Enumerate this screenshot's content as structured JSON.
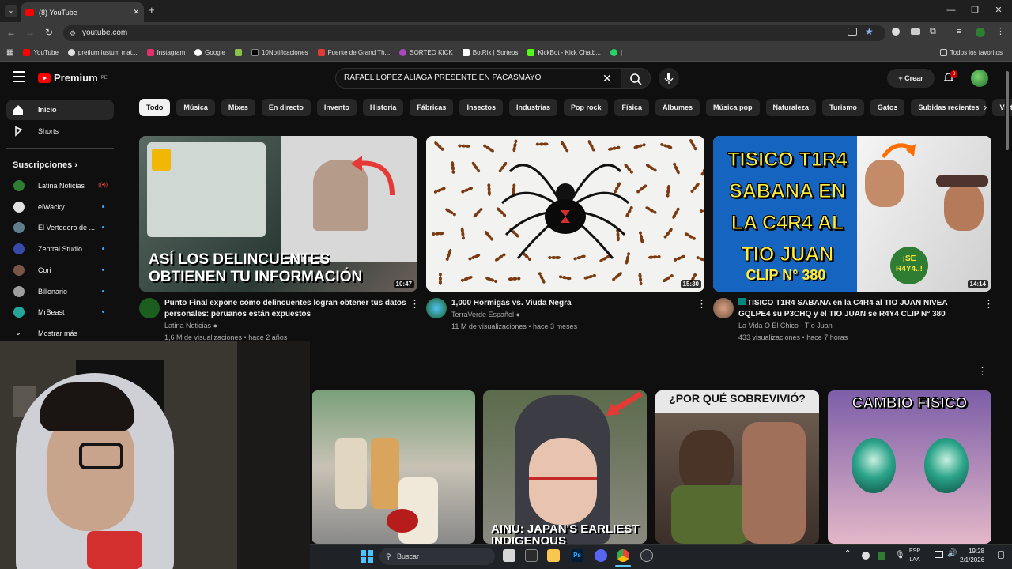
{
  "browser": {
    "tab_title": "(8) YouTube",
    "url": "youtube.com",
    "bookmarks": [
      {
        "label": "YouTube",
        "color": "#ff0000"
      },
      {
        "label": "pretium iustum mat...",
        "color": "#e0e0e0"
      },
      {
        "label": "Instagram",
        "color": "#e1306c"
      },
      {
        "label": "Google",
        "color": "#4285f4"
      },
      {
        "label": "",
        "color": "#8bc34a"
      },
      {
        "label": "10Notificaciones",
        "color": "#000000"
      },
      {
        "label": "Fuente de Grand Th...",
        "color": "#e53935"
      },
      {
        "label": "SORTEO KICK",
        "color": "#ab47bc"
      },
      {
        "label": "BotRix | Sorteos",
        "color": "#ffffff"
      },
      {
        "label": "KickBot - Kick Chatb...",
        "color": "#53fc18"
      },
      {
        "label": "",
        "color": "#25d366"
      },
      {
        "label": "|",
        "color": "#3a3a3a"
      }
    ],
    "all_favorites": "Todos los favoritos"
  },
  "yt": {
    "logo_text": "Premium",
    "logo_region": "PE",
    "search_query": "RAFAEL LÓPEZ ALIAGA PRESENTE EN PACASMAYO",
    "create_label": "Crear",
    "notif_count": "8",
    "chips": [
      "Todo",
      "Música",
      "Mixes",
      "En directo",
      "Invento",
      "Historia",
      "Fábricas",
      "Insectos",
      "Industrias",
      "Pop rock",
      "Física",
      "Álbumes",
      "Música pop",
      "Naturaleza",
      "Turismo",
      "Gatos",
      "Subidas recientes",
      "Visto"
    ]
  },
  "sidebar": {
    "home": "Inicio",
    "shorts": "Shorts",
    "subs_heading": "Suscripciones",
    "subs_chevron": "›",
    "subscriptions": [
      {
        "name": "Latina Noticias",
        "live": "((•))",
        "color": "#2e7d32"
      },
      {
        "name": "elWacky",
        "color": "#e0e0e0"
      },
      {
        "name": "El Vertedero de ...",
        "color": "#607d8b"
      },
      {
        "name": "Zentral Studio",
        "color": "#3949ab"
      },
      {
        "name": "Cori",
        "color": "#795548"
      },
      {
        "name": "Billonario",
        "color": "#9e9e9e"
      },
      {
        "name": "MrBeast",
        "color": "#26a69a"
      }
    ],
    "show_more": "Mostrar más"
  },
  "videos": [
    {
      "title_line1": "Punto Final expone cómo delincuentes logran obtener tus datos",
      "title_line2": "personales: peruanos están expuestos",
      "channel": "Latina Noticias",
      "meta": "1,6 M de visualizaciones • hace 2 años",
      "duration": "10:47",
      "thumb_text": "ASÍ LOS DELINCUENTES OBTIENEN TU INFORMACIÓN"
    },
    {
      "title_line1": "1,000 Hormigas vs. Viuda Negra",
      "title_line2": "",
      "channel": "TerraVerde Español",
      "meta": "11 M de visualizaciones • hace 3 meses",
      "duration": "15:30",
      "thumb_text": ""
    },
    {
      "title_line1": "TISICO T1R4 SABANA en la C4R4 al TIO JUAN NIVEA",
      "title_line2": "GQLPE4 su P3CHQ y el TIO JUAN se R4Y4 CLIP N° 380",
      "channel": "La Vida O El Chico - Tío Juan",
      "meta": "433 visualizaciones • hace 7 horas",
      "duration": "14:14",
      "thumb_text_1": "TISICO T1R4",
      "thumb_text_2": "SABANA EN",
      "thumb_text_3": "LA C4R4 AL",
      "thumb_text_4": "TIO JUAN",
      "thumb_text_5": "CLIP N° 380",
      "thumb_badge": "¡SE R4Y4..!"
    }
  ],
  "shorts": [
    {
      "overlay": ""
    },
    {
      "overlay": "AINU: JAPAN'S EARLIEST INDIGENOUS"
    },
    {
      "overlay": "¿POR QUÉ SOBREVIVIÓ?"
    },
    {
      "overlay": "CAMBIO FISICO"
    }
  ],
  "taskbar": {
    "search_placeholder": "Buscar",
    "lang_1": "ESP",
    "lang_2": "LAA",
    "time": "19:28",
    "date": "2/1/2026"
  }
}
